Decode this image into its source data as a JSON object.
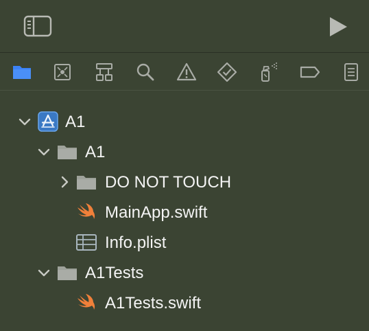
{
  "toolbar": {
    "sidebar_toggle_icon": "sidebar-left-icon",
    "run_icon": "play-icon"
  },
  "navigator_tabs": [
    {
      "name": "project-navigator",
      "icon": "folder-icon",
      "selected": true
    },
    {
      "name": "source-control-navigator",
      "icon": "source-control-icon",
      "selected": false
    },
    {
      "name": "symbol-navigator",
      "icon": "hierarchy-icon",
      "selected": false
    },
    {
      "name": "find-navigator",
      "icon": "magnifier-icon",
      "selected": false
    },
    {
      "name": "issue-navigator",
      "icon": "warning-icon",
      "selected": false
    },
    {
      "name": "test-navigator",
      "icon": "diamond-check-icon",
      "selected": false
    },
    {
      "name": "debug-navigator",
      "icon": "spray-icon",
      "selected": false
    },
    {
      "name": "breakpoint-navigator",
      "icon": "breakpoint-icon",
      "selected": false
    },
    {
      "name": "report-navigator",
      "icon": "report-icon",
      "selected": false
    }
  ],
  "tree": {
    "project": "A1",
    "group_a1": "A1",
    "group_do_not_touch": "DO NOT TOUCH",
    "file_mainapp": "MainApp.swift",
    "file_info": "Info.plist",
    "group_tests": "A1Tests",
    "file_tests": "A1Tests.swift"
  },
  "colors": {
    "background": "#3b4433",
    "accent": "#3b82f6",
    "icon_gray": "#a9aca6",
    "swift_orange": "#f0803a"
  }
}
